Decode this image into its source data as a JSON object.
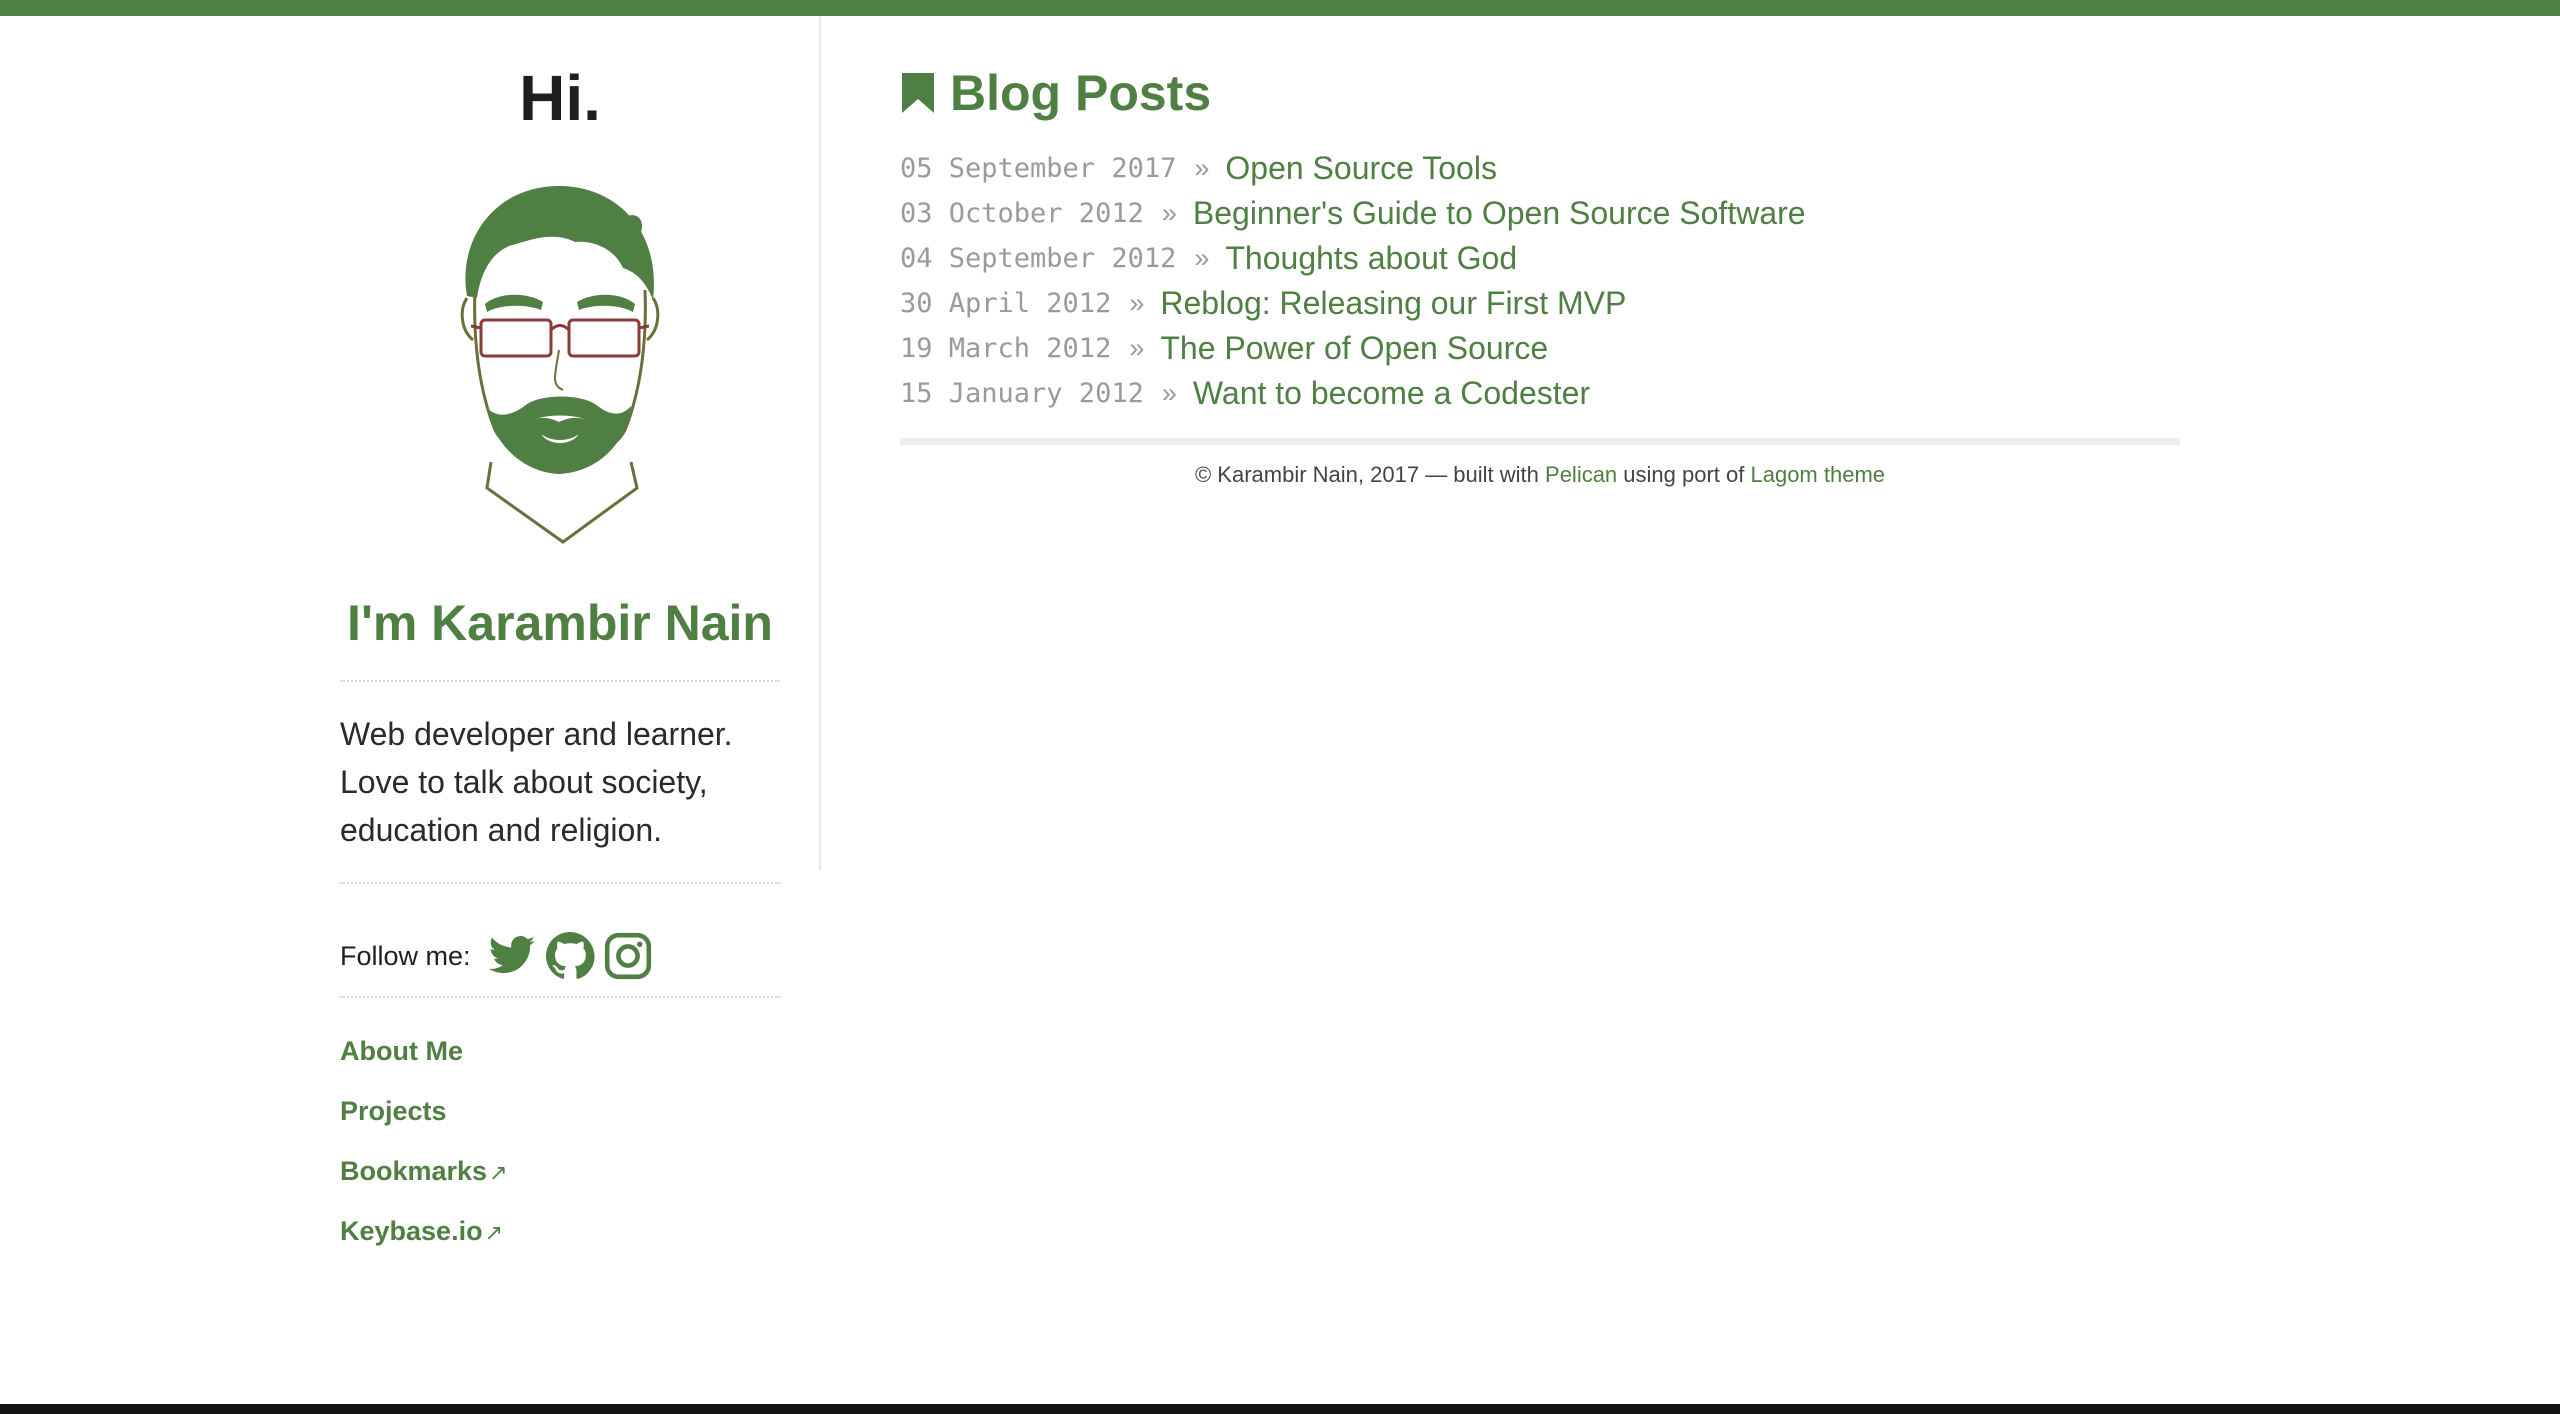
{
  "colors": {
    "accent": "#4f7f42",
    "text": "#222222",
    "muted": "#9a9a9a",
    "avatar_stroke": "#6b6f3a",
    "glasses": "#8a3b3b"
  },
  "sidebar": {
    "greeting": "Hi.",
    "avatar_icon": "avatar-illustration",
    "name": "I'm Karambir Nain",
    "bio": "Web developer and learner. Love to talk about society, education and religion.",
    "follow_label": "Follow me:",
    "social": [
      {
        "icon": "twitter-icon"
      },
      {
        "icon": "github-icon"
      },
      {
        "icon": "instagram-icon"
      }
    ],
    "nav": [
      {
        "label": "About Me",
        "external": false
      },
      {
        "label": "Projects",
        "external": false
      },
      {
        "label": "Bookmarks",
        "external": true,
        "ext_glyph": "↗"
      },
      {
        "label": "Keybase.io",
        "external": true,
        "ext_glyph": "↗"
      }
    ]
  },
  "main": {
    "title": "Blog Posts",
    "title_icon": "bookmark-icon",
    "separator": "»",
    "posts": [
      {
        "date": "05 September 2017",
        "title": "Open Source Tools"
      },
      {
        "date": "03 October 2012",
        "title": "Beginner's Guide to Open Source Software"
      },
      {
        "date": "04 September 2012",
        "title": "Thoughts about God"
      },
      {
        "date": "30 April 2012",
        "title": "Reblog: Releasing our First MVP"
      },
      {
        "date": "19 March 2012",
        "title": "The Power of Open Source"
      },
      {
        "date": "15 January 2012",
        "title": "Want to become a Codester"
      }
    ]
  },
  "footer": {
    "prefix": "© Karambir Nain, 2017 — built with ",
    "pelican": "Pelican",
    "middle": " using port of ",
    "lagom": "Lagom theme"
  }
}
